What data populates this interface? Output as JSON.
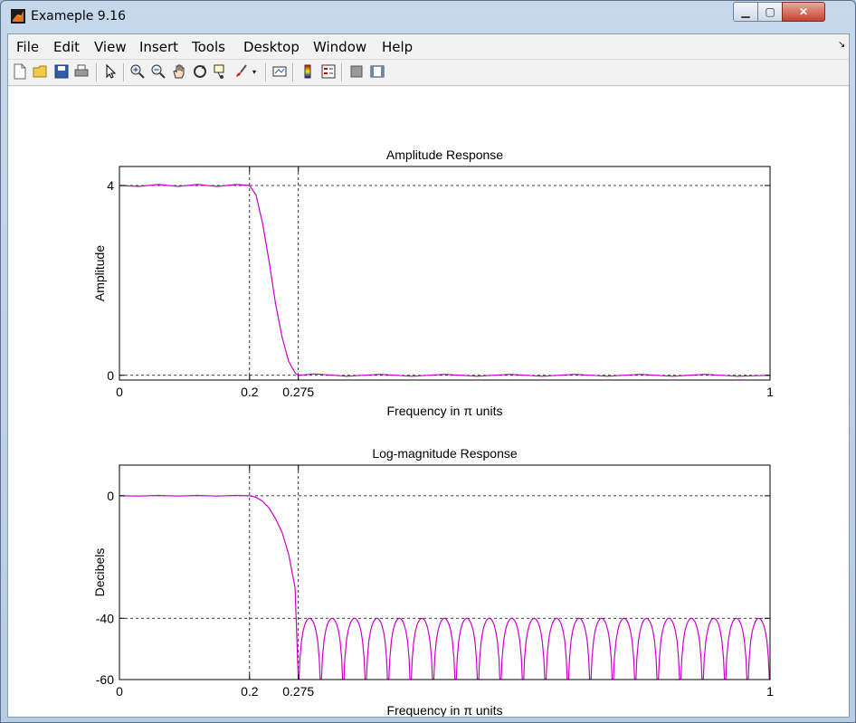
{
  "window": {
    "title": "Exameple 9.16"
  },
  "menu": [
    "File",
    "Edit",
    "View",
    "Insert",
    "Tools",
    "Desktop",
    "Window",
    "Help"
  ],
  "toolbar_icons": [
    "new-file-icon",
    "open-folder-icon",
    "save-icon",
    "print-icon",
    "pointer-icon",
    "zoom-in-icon",
    "zoom-out-icon",
    "pan-hand-icon",
    "rotate-3d-icon",
    "data-cursor-icon",
    "brush-icon",
    "brush-dropdown-icon",
    "link-plot-icon",
    "colorbar-icon",
    "legend-icon",
    "hide-plot-tools-icon",
    "show-plot-tools-icon"
  ],
  "colors": {
    "curve": "#cc00cc",
    "axes": "#000000",
    "grid": "#000000"
  },
  "chart_data": [
    {
      "type": "line",
      "title": "Amplitude Response",
      "xlabel": "Frequency in π units",
      "ylabel": "Amplitude",
      "xlim": [
        0,
        1
      ],
      "ylim": [
        -0.1,
        4.4
      ],
      "xticks": [
        0,
        0.2,
        0.275,
        1
      ],
      "xtick_labels": [
        "0",
        "0.2",
        "0.275",
        "1"
      ],
      "yticks": [
        0,
        4
      ],
      "ytick_labels": [
        "0",
        "4"
      ],
      "grid": "dashed at ticks",
      "series": [
        {
          "x": [
            0,
            0.03,
            0.06,
            0.09,
            0.12,
            0.15,
            0.18,
            0.2,
            0.21,
            0.22,
            0.23,
            0.24,
            0.25,
            0.26,
            0.27,
            0.275,
            0.3,
            0.35,
            0.4,
            0.45,
            0.5,
            0.55,
            0.6,
            0.65,
            0.7,
            0.75,
            0.8,
            0.85,
            0.9,
            0.95,
            1
          ],
          "values": [
            4.0,
            3.98,
            4.02,
            3.98,
            4.02,
            3.98,
            4.02,
            4.0,
            3.8,
            3.2,
            2.4,
            1.5,
            0.8,
            0.3,
            0.05,
            0.0,
            0.03,
            -0.02,
            0.02,
            -0.02,
            0.02,
            -0.02,
            0.02,
            -0.02,
            0.02,
            -0.02,
            0.02,
            -0.02,
            0.02,
            -0.02,
            0.0
          ]
        }
      ]
    },
    {
      "type": "line",
      "title": "Log-magnitude Response",
      "xlabel": "Frequency in π units",
      "ylabel": "Decibels",
      "xlim": [
        0,
        1
      ],
      "ylim": [
        -60,
        10
      ],
      "xticks": [
        0,
        0.2,
        0.275,
        1
      ],
      "xtick_labels": [
        "0",
        "0.2",
        "0.275",
        "1"
      ],
      "yticks": [
        -60,
        -40,
        0
      ],
      "ytick_labels": [
        "-60",
        "-40",
        "0"
      ],
      "grid": "dashed at ticks",
      "passband": {
        "x": [
          0,
          0.03,
          0.06,
          0.09,
          0.12,
          0.15,
          0.18,
          0.2,
          0.21,
          0.22,
          0.23,
          0.24,
          0.25,
          0.26,
          0.27,
          0.275
        ],
        "values": [
          0,
          -0.1,
          0.1,
          -0.1,
          0.1,
          -0.1,
          0.1,
          0,
          -0.5,
          -1.8,
          -4,
          -7.5,
          -12,
          -19,
          -30,
          -60
        ]
      },
      "stopband": {
        "edge": 0.275,
        "lobe_peak": -40,
        "lobe_count": 21,
        "floor": -60
      }
    }
  ]
}
